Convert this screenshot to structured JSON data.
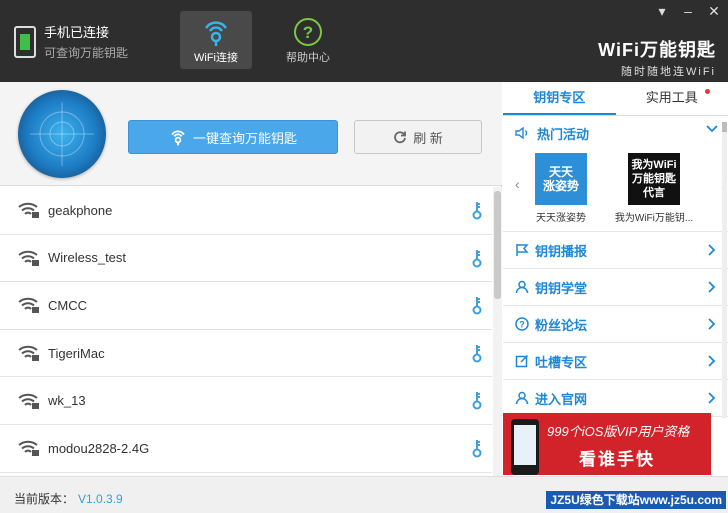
{
  "header": {
    "status_title": "手机已连接",
    "status_subtitle": "可查询万能钥匙",
    "nav": [
      {
        "label": "WiFi连接",
        "icon": "wifi-key-icon",
        "active": true
      },
      {
        "label": "帮助中心",
        "icon": "help-icon",
        "active": false
      }
    ],
    "brand_title": "WiFi万能钥匙",
    "brand_subtitle": "随时随地连WiFi",
    "window_controls": [
      "menu-icon",
      "minimize-icon",
      "close-icon"
    ]
  },
  "left": {
    "query_button": "一键查询万能钥匙",
    "refresh_button": "刷 新",
    "networks": [
      {
        "ssid": "geakphone"
      },
      {
        "ssid": "Wireless_test"
      },
      {
        "ssid": "CMCC"
      },
      {
        "ssid": "TigeriMac"
      },
      {
        "ssid": "wk_13"
      },
      {
        "ssid": "modou2828-2.4G"
      }
    ]
  },
  "right": {
    "tabs": [
      {
        "label": "钥钥专区",
        "active": true
      },
      {
        "label": "实用工具",
        "active": false,
        "badge": true
      }
    ],
    "hot_title": "热门活动",
    "promos": [
      {
        "caption": "天天涨姿势",
        "thumb_text": "天天\n涨姿势"
      },
      {
        "caption": "我为WiFi万能钥...",
        "thumb_text": "我为WiFi\n万能钥匙\n代言"
      }
    ],
    "menu": [
      {
        "label": "钥钥播报",
        "icon": "flag-icon"
      },
      {
        "label": "钥钥学堂",
        "icon": "user-icon"
      },
      {
        "label": "粉丝论坛",
        "icon": "question-icon"
      },
      {
        "label": "吐槽专区",
        "icon": "edit-icon"
      },
      {
        "label": "进入官网",
        "icon": "user-icon"
      }
    ],
    "banner_line1": "999个iOS版VIP用户资格",
    "banner_line2": "看谁手快"
  },
  "footer": {
    "version_label": "当前版本：",
    "version_value": "V1.0.3.9",
    "watermark": "JZ5U绿色下载站www.jz5u.com"
  },
  "colors": {
    "accent": "#1e88d8",
    "header_bg": "#2e2e2e",
    "query_button": "#4aa8ea",
    "banner_bg": "#d2232a"
  }
}
